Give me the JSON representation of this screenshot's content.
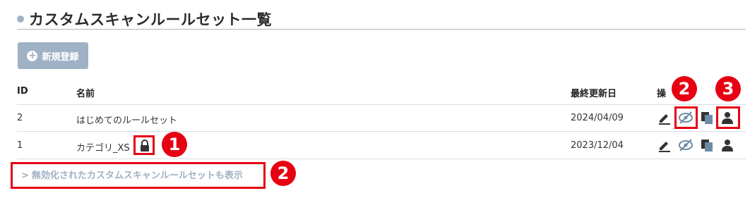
{
  "page": {
    "title": "カスタムスキャンルールセット一覧"
  },
  "toolbar": {
    "new_button_label": "新規登録",
    "new_button_icon": "plus-circle-icon"
  },
  "table": {
    "headers": {
      "id": "ID",
      "name": "名前",
      "updated": "最終更新日",
      "actions": "操"
    },
    "rows": [
      {
        "id": "2",
        "name": "はじめてのルールセット",
        "updated": "2024/04/09",
        "locked": false
      },
      {
        "id": "1",
        "name": "カテゴリ_XS",
        "updated": "2023/12/04",
        "locked": true
      }
    ]
  },
  "footer": {
    "show_disabled_chevron": ">",
    "show_disabled_label": "無効化されたカスタムスキャンルールセットも表示"
  },
  "annotations": {
    "badge1": "1",
    "badge2_top": "2",
    "badge3": "3",
    "badge2_bottom": "2"
  },
  "colors": {
    "accent": "#9fb1c4",
    "annotation_red": "#e60012",
    "icon_dark": "#333333",
    "icon_blue": "#6f8aa3"
  },
  "icons": [
    "edit-icon",
    "visibility-off-icon",
    "copy-icon",
    "user-icon",
    "lock-icon"
  ]
}
